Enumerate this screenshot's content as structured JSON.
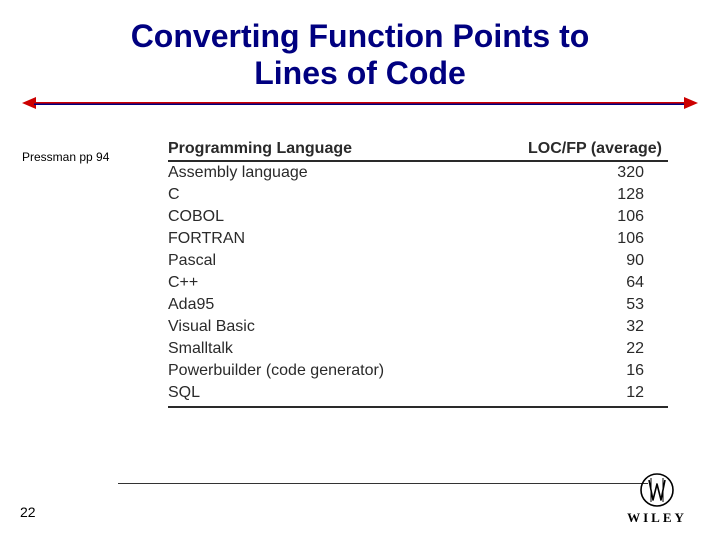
{
  "title_line1": "Converting Function Points to",
  "title_line2": "Lines of Code",
  "citation": "Pressman pp 94",
  "table": {
    "header_col1": "Programming Language",
    "header_col2": "LOC/FP (average)",
    "rows": [
      {
        "lang": "Assembly language",
        "loc": "320"
      },
      {
        "lang": "C",
        "loc": "128"
      },
      {
        "lang": "COBOL",
        "loc": "106"
      },
      {
        "lang": "FORTRAN",
        "loc": "106"
      },
      {
        "lang": "Pascal",
        "loc": "90"
      },
      {
        "lang": "C++",
        "loc": "64"
      },
      {
        "lang": "Ada95",
        "loc": "53"
      },
      {
        "lang": "Visual Basic",
        "loc": "32"
      },
      {
        "lang": "Smalltalk",
        "loc": "22"
      },
      {
        "lang": "Powerbuilder (code generator)",
        "loc": "16"
      },
      {
        "lang": "SQL",
        "loc": "12"
      }
    ]
  },
  "page_number": "22",
  "brand": "WILEY"
}
